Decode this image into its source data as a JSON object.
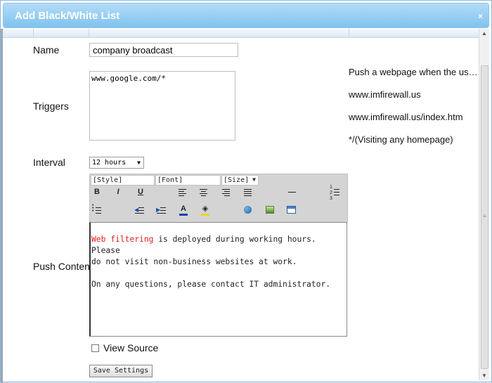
{
  "dialog": {
    "title": "Add Black/White List",
    "close_glyph": "×"
  },
  "form": {
    "name_label": "Name",
    "name_value": "company broadcast",
    "triggers_label": "Triggers",
    "triggers_value": "www.google.com/*",
    "interval_label": "Interval",
    "interval_value": "12 hours",
    "push_content_label": "Push Content",
    "view_source_label": "View Source",
    "view_source_checked": false,
    "save_label": "Save Settings"
  },
  "hints": [
    "Push a webpage when the us…",
    "www.imfirewall.us",
    "www.imfirewall.us/index.htm",
    "*/(Visiting any homepage)"
  ],
  "editor_toolbar": {
    "style_select": "[Style]",
    "font_select": "[Font]",
    "size_select": "[Size]",
    "buttons": [
      {
        "name": "bold",
        "glyph": "B"
      },
      {
        "name": "italic",
        "glyph": "I"
      },
      {
        "name": "underline",
        "glyph": "U"
      }
    ]
  },
  "editor": {
    "highlight": "Web filtering",
    "line1_rest": " is deployed during working hours. Please",
    "line2": "do not visit non-business websites at work.",
    "line3": "On any questions, please contact IT administrator.",
    "highlight_color": "#e21c1c"
  },
  "colors": {
    "titlebar": "#7fc2ee",
    "title_text": "#ffffff"
  }
}
